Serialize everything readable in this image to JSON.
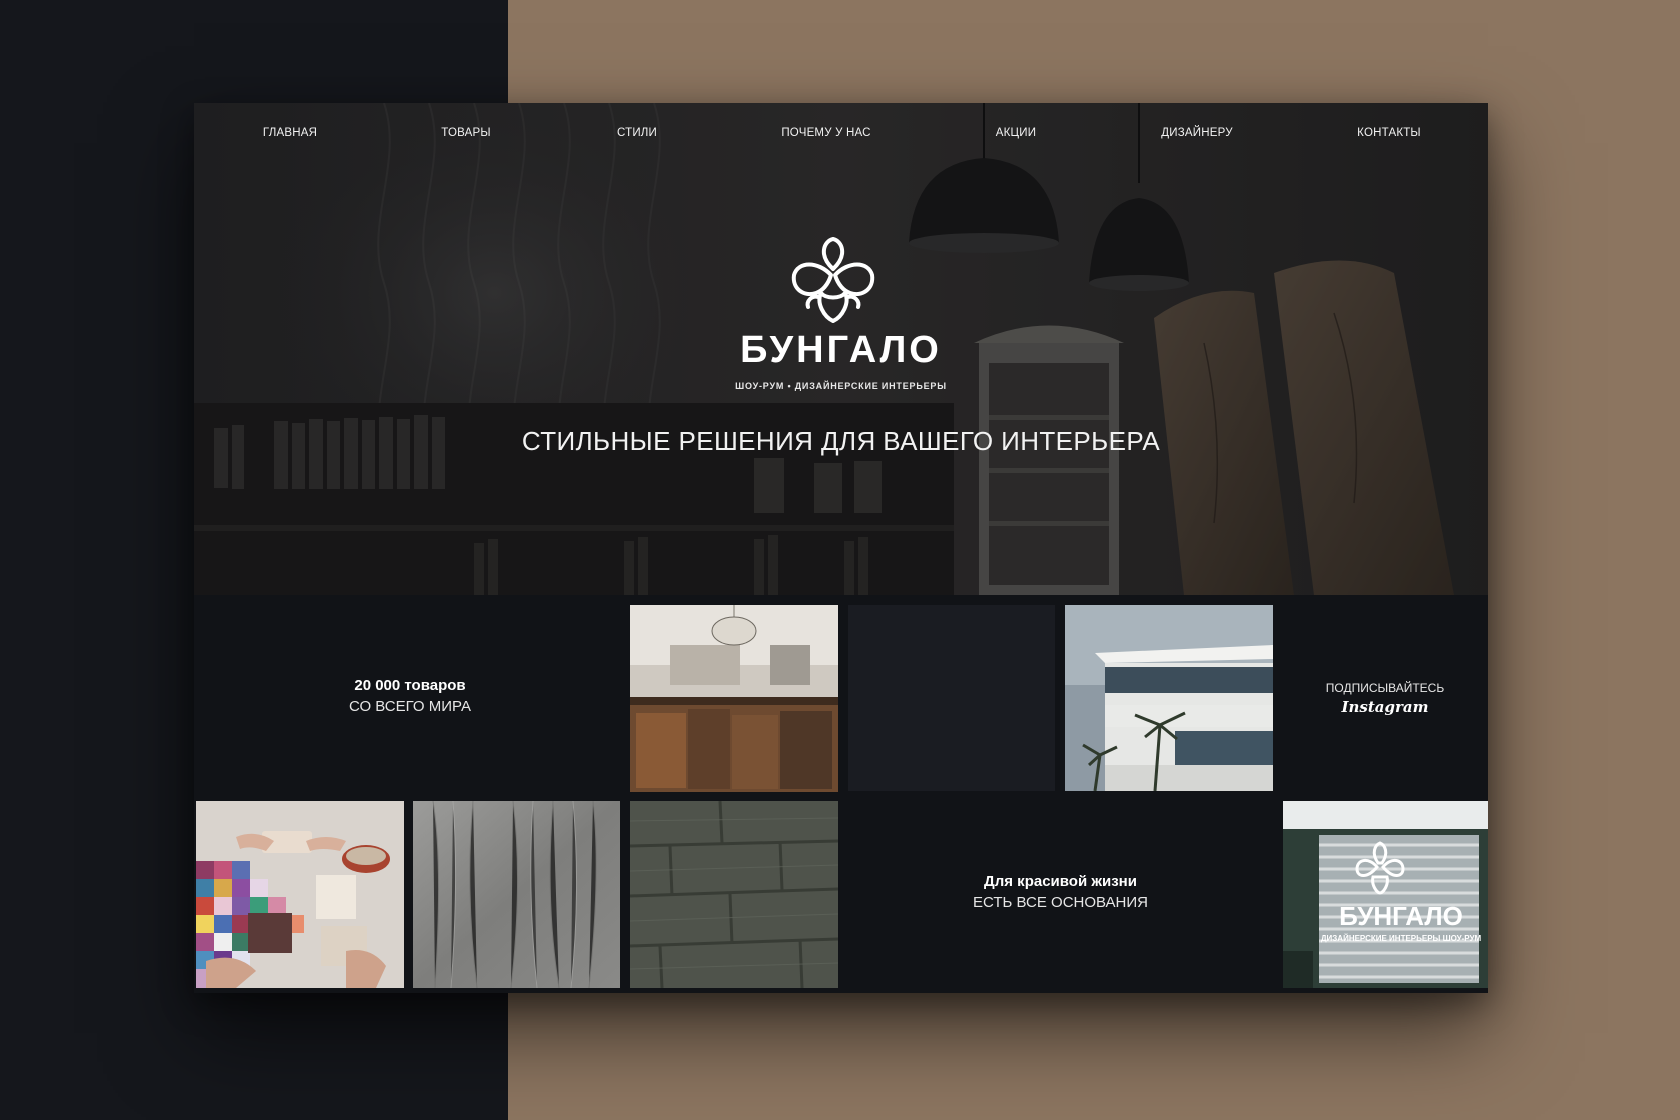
{
  "nav": {
    "items": [
      {
        "label": "ГЛАВНАЯ"
      },
      {
        "label": "ТОВАРЫ"
      },
      {
        "label": "СТИЛИ"
      },
      {
        "label": "ПОЧЕМУ У НАС"
      },
      {
        "label": "АКЦИИ"
      },
      {
        "label": "ДИЗАЙНЕРУ"
      },
      {
        "label": "КОНТАКТЫ"
      }
    ]
  },
  "hero": {
    "logo_icon": "orchid-icon",
    "brand": "БУНГАЛО",
    "tagline": "ШОУ-РУМ  •  ДИЗАЙНЕРСКИЕ ИНТЕРЬЕРЫ",
    "title": "СТИЛЬНЫЕ РЕШЕНИЯ ДЛЯ ВАШЕГО ИНТЕРЬЕРА"
  },
  "tiles": {
    "goods": {
      "bold": "20 000 товаров",
      "regular": "СО ВСЕГО МИРА"
    },
    "instagram": {
      "top": "ПОДПИСЫВАЙТЕСЬ",
      "brand": "Instagram"
    },
    "life": {
      "bold": "Для красивой жизни",
      "regular": "ЕСТЬ ВСЕ ОСНОВАНИЯ"
    },
    "storefront": {
      "sign": "БУНГАЛО",
      "sub": "ДИЗАЙНЕРСКИЕ ИНТЕРЬЕРЫ  ШОУ-РУМ"
    }
  },
  "colors": {
    "page_left": "#15171c",
    "page_right": "#8c7560",
    "site_bg": "#111317",
    "text": "#ffffff"
  }
}
